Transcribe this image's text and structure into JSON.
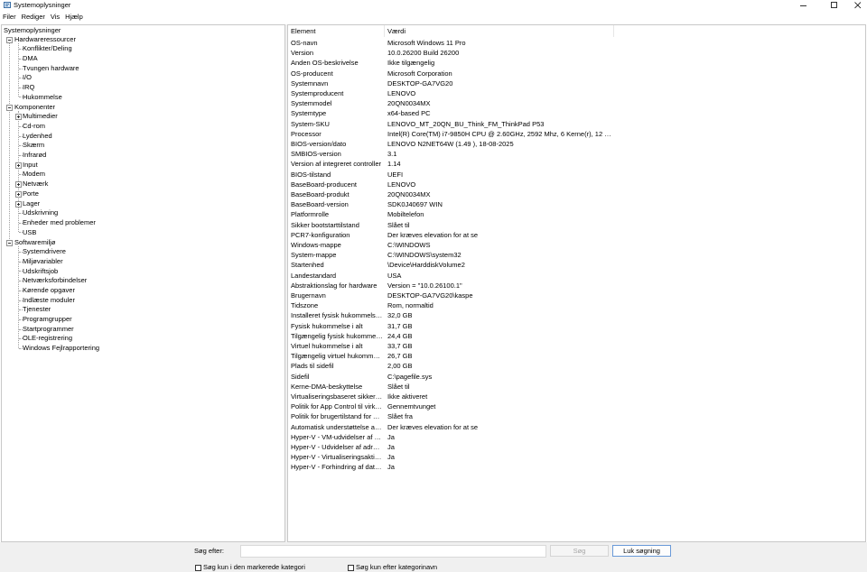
{
  "window": {
    "title": "Systemoplysninger",
    "icons": [
      "msinfo-app-icon",
      "minimize-icon",
      "maximize-icon",
      "close-icon"
    ]
  },
  "menu": [
    "Filer",
    "Rediger",
    "Vis",
    "Hjælp"
  ],
  "tree": {
    "root": "Systemoplysninger",
    "groups": [
      {
        "label": "Hardwareressourcer",
        "children": [
          "Konflikter/Deling",
          "DMA",
          "Tvungen hardware",
          "I/O",
          "IRQ",
          "Hukommelse"
        ]
      },
      {
        "label": "Komponenter",
        "children": [
          {
            "label": "Multimedier",
            "expandable": true
          },
          {
            "label": "Cd-rom",
            "expandable": false
          },
          {
            "label": "Lydenhed",
            "expandable": false
          },
          {
            "label": "Skærm",
            "expandable": false
          },
          {
            "label": "Infrarød",
            "expandable": false
          },
          {
            "label": "Input",
            "expandable": true
          },
          {
            "label": "Modem",
            "expandable": false
          },
          {
            "label": "Netværk",
            "expandable": true
          },
          {
            "label": "Porte",
            "expandable": true
          },
          {
            "label": "Lager",
            "expandable": true
          },
          {
            "label": "Udskrivning",
            "expandable": false
          },
          {
            "label": "Enheder med problemer",
            "expandable": false
          },
          {
            "label": "USB",
            "expandable": false
          }
        ]
      },
      {
        "label": "Softwaremiljø",
        "children": [
          "Systemdrivere",
          "Miljøvariabler",
          "Udskriftsjob",
          "Netværksforbindelser",
          "Kørende opgaver",
          "Indlæste moduler",
          "Tjenester",
          "Programgrupper",
          "Startprogrammer",
          "OLE-registrering",
          "Windows Fejlrapportering"
        ]
      }
    ]
  },
  "details": {
    "columns": [
      "Element",
      "Værdi"
    ],
    "rows": [
      [
        "OS-navn",
        "Microsoft Windows 11 Pro"
      ],
      [
        "Version",
        "10.0.26200 Build 26200"
      ],
      [
        "Anden OS-beskrivelse",
        "Ikke tilgængelig"
      ],
      [
        "OS-producent",
        "Microsoft Corporation"
      ],
      [
        "Systemnavn",
        "DESKTOP-GA7VG20"
      ],
      [
        "Systemproducent",
        "LENOVO"
      ],
      [
        "Systemmodel",
        "20QN0034MX"
      ],
      [
        "Systemtype",
        "x64-based PC"
      ],
      [
        "System-SKU",
        "LENOVO_MT_20QN_BU_Think_FM_ThinkPad P53"
      ],
      [
        "Processor",
        "Intel(R) Core(TM) i7-9850H CPU @ 2.60GHz, 2592 Mhz, 6 Kerne(r), 12 Logisk(e..."
      ],
      [
        "BIOS-version/dato",
        "LENOVO N2NET64W (1.49 ), 18-08-2025"
      ],
      [
        "SMBIOS-version",
        "3.1"
      ],
      [
        "Version af integreret controller",
        "1.14"
      ],
      [
        "BIOS-tilstand",
        "UEFI"
      ],
      [
        "BaseBoard-producent",
        "LENOVO"
      ],
      [
        "BaseBoard-produkt",
        "20QN0034MX"
      ],
      [
        "BaseBoard-version",
        "SDK0J40697 WIN"
      ],
      [
        "Platformrolle",
        "Mobiltelefon"
      ],
      [
        "Sikker bootstarttilstand",
        "Slået til"
      ],
      [
        "PCR7-konfiguration",
        "Der kræves elevation for at se"
      ],
      [
        "Windows-mappe",
        "C:\\WINDOWS"
      ],
      [
        "System-mappe",
        "C:\\WINDOWS\\system32"
      ],
      [
        "Startenhed",
        "\\Device\\HarddiskVolume2"
      ],
      [
        "Landestandard",
        "USA"
      ],
      [
        "Abstraktionslag for hardware",
        "Version = \"10.0.26100.1\""
      ],
      [
        "Brugernavn",
        "DESKTOP-GA7VG20\\kaspe"
      ],
      [
        "Tidszone",
        "Rom, normaltid"
      ],
      [
        "Installeret fysisk hukommelse (...",
        "32,0 GB"
      ],
      [
        "Fysisk hukommelse i alt",
        "31,7 GB"
      ],
      [
        "Tilgængelig fysisk hukommelse",
        "24,4 GB"
      ],
      [
        "Virtuel hukommelse i alt",
        "33,7 GB"
      ],
      [
        "Tilgængelig virtuel hukommelse",
        "26,7 GB"
      ],
      [
        "Plads til sidefil",
        "2,00 GB"
      ],
      [
        "Sidefil",
        "C:\\pagefile.sys"
      ],
      [
        "Kerne-DMA-beskyttelse",
        "Slået til"
      ],
      [
        "Virtualiseringsbaseret sikkerhed",
        "Ikke aktiveret"
      ],
      [
        "Politik for App Control til virkso...",
        "Gennemtvunget"
      ],
      [
        "Politik for brugertilstand for Ap...",
        "Slået fra"
      ],
      [
        "Automatisk understøttelse af E...",
        "Der kræves elevation for at se"
      ],
      [
        "Hyper-V - VM-udvidelser af ov...",
        "Ja"
      ],
      [
        "Hyper-V - Udvidelser af adress...",
        "Ja"
      ],
      [
        "Hyper-V - Virtualiseringsaktiver...",
        "Ja"
      ],
      [
        "Hyper-V - Forhindring af datak...",
        "Ja"
      ]
    ]
  },
  "search": {
    "label": "Søg efter:",
    "value": "",
    "search_button": "Søg",
    "close_button": "Luk søgning",
    "check_selected_category": "Søg kun i den markerede kategori",
    "check_category_names": "Søg kun efter kategorinavn"
  }
}
